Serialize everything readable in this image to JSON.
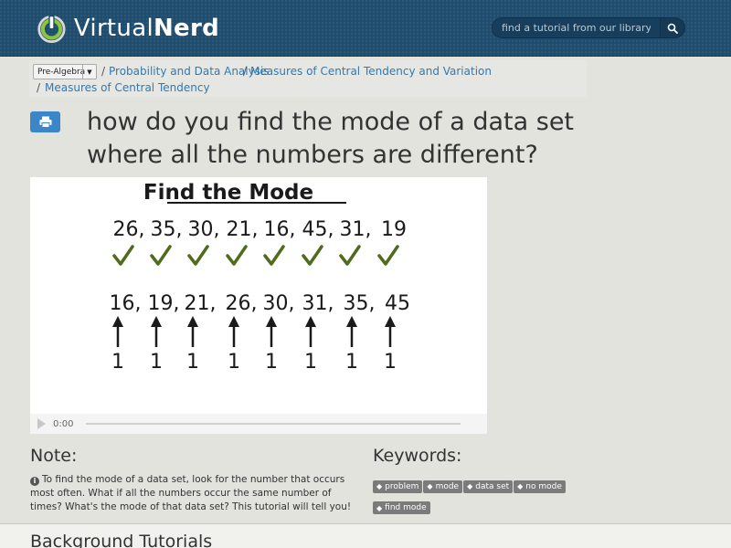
{
  "header": {
    "logo_part1": "Virtual",
    "logo_part2": "Nerd",
    "search_placeholder": "find a tutorial from our library"
  },
  "breadcrumb": {
    "subject": "Pre-Algebra",
    "items": [
      "Probability and Data Analysis",
      "Measures of Central Tendency and Variation",
      "Measures of Central Tendency"
    ]
  },
  "title": "how do you find the mode of a data set where all the numbers are different?",
  "video": {
    "heading": "Find the Mode",
    "row1": [
      "26,",
      "35,",
      "30,",
      "21,",
      "16,",
      "45,",
      "31,",
      "19"
    ],
    "row2": [
      "16,",
      "19,",
      "21,",
      "26,",
      "30,",
      "31,",
      "35,",
      "45"
    ],
    "counts": [
      "1",
      "1",
      "1",
      "1",
      "1",
      "1",
      "1",
      "1"
    ],
    "time": "0:00"
  },
  "note": {
    "heading": "Note:",
    "text": "To find the mode of a data set, look for the number that occurs most often. What if all the numbers occur the same number of times? What's the mode of that data set? This tutorial will tell you!"
  },
  "keywords": {
    "heading": "Keywords:",
    "tags": [
      "problem",
      "mode",
      "data set",
      "no mode",
      "find mode"
    ]
  },
  "background": {
    "heading": "Background Tutorials"
  },
  "colors": {
    "header_bg": "#1f4d6e",
    "link": "#2e7ab8",
    "accent_green": "#8cc63e",
    "check_green": "#4f6b1c",
    "print_button": "#3a86c8"
  }
}
